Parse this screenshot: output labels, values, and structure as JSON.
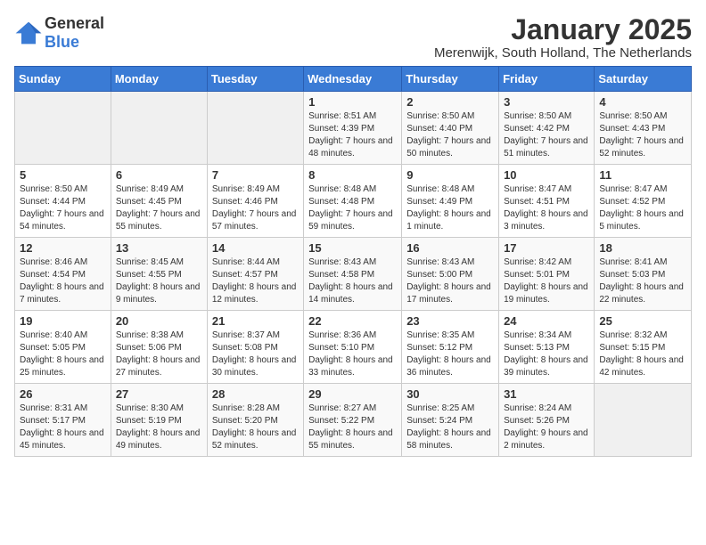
{
  "header": {
    "logo": {
      "general": "General",
      "blue": "Blue"
    },
    "month": "January 2025",
    "location": "Merenwijk, South Holland, The Netherlands"
  },
  "weekdays": [
    "Sunday",
    "Monday",
    "Tuesday",
    "Wednesday",
    "Thursday",
    "Friday",
    "Saturday"
  ],
  "weeks": [
    [
      {
        "day": "",
        "sunrise": "",
        "sunset": "",
        "daylight": "",
        "empty": true
      },
      {
        "day": "",
        "sunrise": "",
        "sunset": "",
        "daylight": "",
        "empty": true
      },
      {
        "day": "",
        "sunrise": "",
        "sunset": "",
        "daylight": "",
        "empty": true
      },
      {
        "day": "1",
        "sunrise": "Sunrise: 8:51 AM",
        "sunset": "Sunset: 4:39 PM",
        "daylight": "Daylight: 7 hours and 48 minutes.",
        "empty": false
      },
      {
        "day": "2",
        "sunrise": "Sunrise: 8:50 AM",
        "sunset": "Sunset: 4:40 PM",
        "daylight": "Daylight: 7 hours and 50 minutes.",
        "empty": false
      },
      {
        "day": "3",
        "sunrise": "Sunrise: 8:50 AM",
        "sunset": "Sunset: 4:42 PM",
        "daylight": "Daylight: 7 hours and 51 minutes.",
        "empty": false
      },
      {
        "day": "4",
        "sunrise": "Sunrise: 8:50 AM",
        "sunset": "Sunset: 4:43 PM",
        "daylight": "Daylight: 7 hours and 52 minutes.",
        "empty": false
      }
    ],
    [
      {
        "day": "5",
        "sunrise": "Sunrise: 8:50 AM",
        "sunset": "Sunset: 4:44 PM",
        "daylight": "Daylight: 7 hours and 54 minutes.",
        "empty": false
      },
      {
        "day": "6",
        "sunrise": "Sunrise: 8:49 AM",
        "sunset": "Sunset: 4:45 PM",
        "daylight": "Daylight: 7 hours and 55 minutes.",
        "empty": false
      },
      {
        "day": "7",
        "sunrise": "Sunrise: 8:49 AM",
        "sunset": "Sunset: 4:46 PM",
        "daylight": "Daylight: 7 hours and 57 minutes.",
        "empty": false
      },
      {
        "day": "8",
        "sunrise": "Sunrise: 8:48 AM",
        "sunset": "Sunset: 4:48 PM",
        "daylight": "Daylight: 7 hours and 59 minutes.",
        "empty": false
      },
      {
        "day": "9",
        "sunrise": "Sunrise: 8:48 AM",
        "sunset": "Sunset: 4:49 PM",
        "daylight": "Daylight: 8 hours and 1 minute.",
        "empty": false
      },
      {
        "day": "10",
        "sunrise": "Sunrise: 8:47 AM",
        "sunset": "Sunset: 4:51 PM",
        "daylight": "Daylight: 8 hours and 3 minutes.",
        "empty": false
      },
      {
        "day": "11",
        "sunrise": "Sunrise: 8:47 AM",
        "sunset": "Sunset: 4:52 PM",
        "daylight": "Daylight: 8 hours and 5 minutes.",
        "empty": false
      }
    ],
    [
      {
        "day": "12",
        "sunrise": "Sunrise: 8:46 AM",
        "sunset": "Sunset: 4:54 PM",
        "daylight": "Daylight: 8 hours and 7 minutes.",
        "empty": false
      },
      {
        "day": "13",
        "sunrise": "Sunrise: 8:45 AM",
        "sunset": "Sunset: 4:55 PM",
        "daylight": "Daylight: 8 hours and 9 minutes.",
        "empty": false
      },
      {
        "day": "14",
        "sunrise": "Sunrise: 8:44 AM",
        "sunset": "Sunset: 4:57 PM",
        "daylight": "Daylight: 8 hours and 12 minutes.",
        "empty": false
      },
      {
        "day": "15",
        "sunrise": "Sunrise: 8:43 AM",
        "sunset": "Sunset: 4:58 PM",
        "daylight": "Daylight: 8 hours and 14 minutes.",
        "empty": false
      },
      {
        "day": "16",
        "sunrise": "Sunrise: 8:43 AM",
        "sunset": "Sunset: 5:00 PM",
        "daylight": "Daylight: 8 hours and 17 minutes.",
        "empty": false
      },
      {
        "day": "17",
        "sunrise": "Sunrise: 8:42 AM",
        "sunset": "Sunset: 5:01 PM",
        "daylight": "Daylight: 8 hours and 19 minutes.",
        "empty": false
      },
      {
        "day": "18",
        "sunrise": "Sunrise: 8:41 AM",
        "sunset": "Sunset: 5:03 PM",
        "daylight": "Daylight: 8 hours and 22 minutes.",
        "empty": false
      }
    ],
    [
      {
        "day": "19",
        "sunrise": "Sunrise: 8:40 AM",
        "sunset": "Sunset: 5:05 PM",
        "daylight": "Daylight: 8 hours and 25 minutes.",
        "empty": false
      },
      {
        "day": "20",
        "sunrise": "Sunrise: 8:38 AM",
        "sunset": "Sunset: 5:06 PM",
        "daylight": "Daylight: 8 hours and 27 minutes.",
        "empty": false
      },
      {
        "day": "21",
        "sunrise": "Sunrise: 8:37 AM",
        "sunset": "Sunset: 5:08 PM",
        "daylight": "Daylight: 8 hours and 30 minutes.",
        "empty": false
      },
      {
        "day": "22",
        "sunrise": "Sunrise: 8:36 AM",
        "sunset": "Sunset: 5:10 PM",
        "daylight": "Daylight: 8 hours and 33 minutes.",
        "empty": false
      },
      {
        "day": "23",
        "sunrise": "Sunrise: 8:35 AM",
        "sunset": "Sunset: 5:12 PM",
        "daylight": "Daylight: 8 hours and 36 minutes.",
        "empty": false
      },
      {
        "day": "24",
        "sunrise": "Sunrise: 8:34 AM",
        "sunset": "Sunset: 5:13 PM",
        "daylight": "Daylight: 8 hours and 39 minutes.",
        "empty": false
      },
      {
        "day": "25",
        "sunrise": "Sunrise: 8:32 AM",
        "sunset": "Sunset: 5:15 PM",
        "daylight": "Daylight: 8 hours and 42 minutes.",
        "empty": false
      }
    ],
    [
      {
        "day": "26",
        "sunrise": "Sunrise: 8:31 AM",
        "sunset": "Sunset: 5:17 PM",
        "daylight": "Daylight: 8 hours and 45 minutes.",
        "empty": false
      },
      {
        "day": "27",
        "sunrise": "Sunrise: 8:30 AM",
        "sunset": "Sunset: 5:19 PM",
        "daylight": "Daylight: 8 hours and 49 minutes.",
        "empty": false
      },
      {
        "day": "28",
        "sunrise": "Sunrise: 8:28 AM",
        "sunset": "Sunset: 5:20 PM",
        "daylight": "Daylight: 8 hours and 52 minutes.",
        "empty": false
      },
      {
        "day": "29",
        "sunrise": "Sunrise: 8:27 AM",
        "sunset": "Sunset: 5:22 PM",
        "daylight": "Daylight: 8 hours and 55 minutes.",
        "empty": false
      },
      {
        "day": "30",
        "sunrise": "Sunrise: 8:25 AM",
        "sunset": "Sunset: 5:24 PM",
        "daylight": "Daylight: 8 hours and 58 minutes.",
        "empty": false
      },
      {
        "day": "31",
        "sunrise": "Sunrise: 8:24 AM",
        "sunset": "Sunset: 5:26 PM",
        "daylight": "Daylight: 9 hours and 2 minutes.",
        "empty": false
      },
      {
        "day": "",
        "sunrise": "",
        "sunset": "",
        "daylight": "",
        "empty": true
      }
    ]
  ]
}
